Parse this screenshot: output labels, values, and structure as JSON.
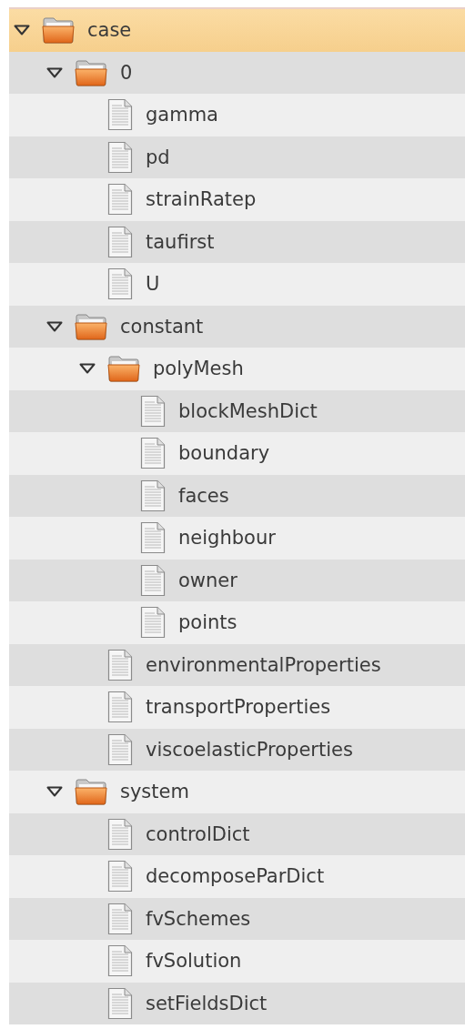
{
  "tree": [
    {
      "kind": "folder",
      "name": "case",
      "expanded": true,
      "selected": true,
      "children": [
        {
          "kind": "folder",
          "name": "0",
          "expanded": true,
          "selected": false,
          "children": [
            {
              "kind": "file",
              "name": "gamma",
              "selected": false
            },
            {
              "kind": "file",
              "name": "pd",
              "selected": false
            },
            {
              "kind": "file",
              "name": "strainRatep",
              "selected": false
            },
            {
              "kind": "file",
              "name": "taufirst",
              "selected": false
            },
            {
              "kind": "file",
              "name": "U",
              "selected": false
            }
          ]
        },
        {
          "kind": "folder",
          "name": "constant",
          "expanded": true,
          "selected": false,
          "children": [
            {
              "kind": "folder",
              "name": "polyMesh",
              "expanded": true,
              "selected": false,
              "children": [
                {
                  "kind": "file",
                  "name": "blockMeshDict",
                  "selected": false
                },
                {
                  "kind": "file",
                  "name": "boundary",
                  "selected": false
                },
                {
                  "kind": "file",
                  "name": "faces",
                  "selected": false
                },
                {
                  "kind": "file",
                  "name": "neighbour",
                  "selected": false
                },
                {
                  "kind": "file",
                  "name": "owner",
                  "selected": false
                },
                {
                  "kind": "file",
                  "name": "points",
                  "selected": false
                }
              ]
            },
            {
              "kind": "file",
              "name": "environmentalProperties",
              "selected": false
            },
            {
              "kind": "file",
              "name": "transportProperties",
              "selected": false
            },
            {
              "kind": "file",
              "name": "viscoelasticProperties",
              "selected": false
            }
          ]
        },
        {
          "kind": "folder",
          "name": "system",
          "expanded": true,
          "selected": false,
          "children": [
            {
              "kind": "file",
              "name": "controlDict",
              "selected": false
            },
            {
              "kind": "file",
              "name": "decomposeParDict",
              "selected": false
            },
            {
              "kind": "file",
              "name": "fvSchemes",
              "selected": false
            },
            {
              "kind": "file",
              "name": "fvSolution",
              "selected": false
            },
            {
              "kind": "file",
              "name": "setFieldsDict",
              "selected": false
            }
          ]
        }
      ]
    }
  ]
}
